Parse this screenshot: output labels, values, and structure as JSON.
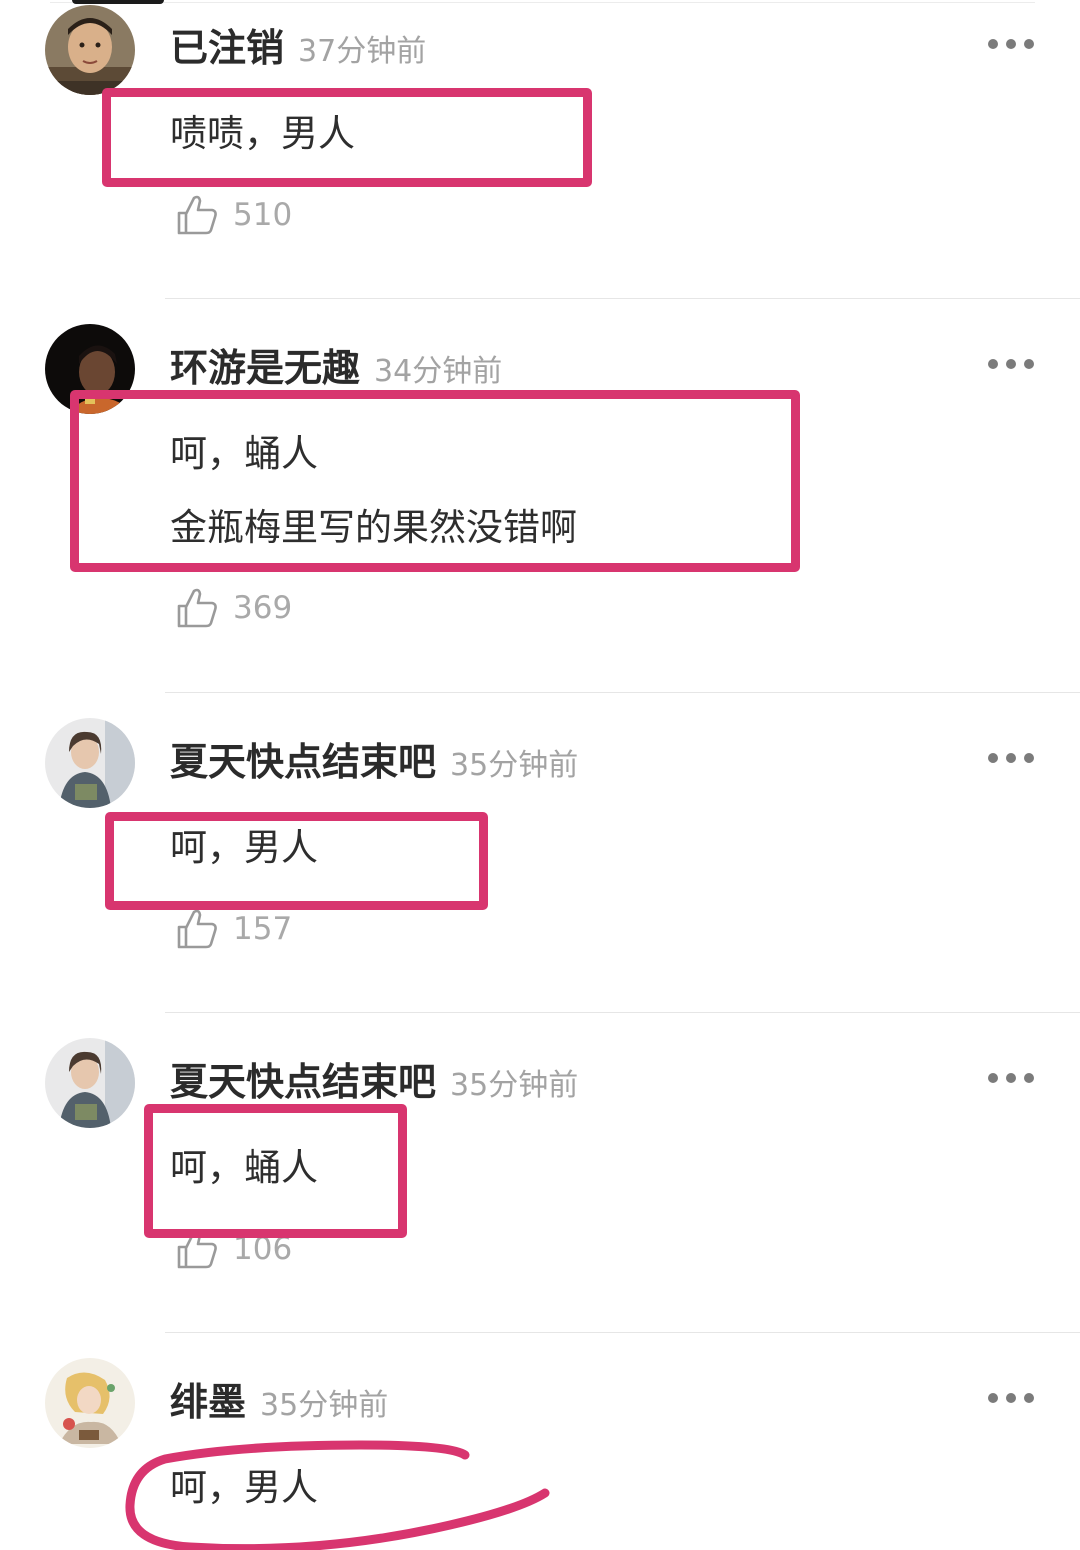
{
  "comments": [
    {
      "username": "已注销",
      "time": "37分钟前",
      "lines": [
        "啧啧，男人"
      ],
      "likes": "510",
      "avatar": "avatar-man-photo"
    },
    {
      "username": "环游是无趣",
      "time": "34分钟前",
      "lines": [
        "呵，蛹人",
        "金瓶梅里写的果然没错啊"
      ],
      "likes": "369",
      "avatar": "avatar-dark-portrait"
    },
    {
      "username": "夏天快点结束吧",
      "time": "35分钟前",
      "lines": [
        "呵，男人"
      ],
      "likes": "157",
      "avatar": "avatar-girl-photo"
    },
    {
      "username": "夏天快点结束吧",
      "time": "35分钟前",
      "lines": [
        "呵，蛹人"
      ],
      "likes": "106",
      "avatar": "avatar-girl-photo"
    },
    {
      "username": "绯墨",
      "time": "35分钟前",
      "lines": [
        "呵，男人"
      ],
      "likes": "",
      "avatar": "avatar-illustration"
    }
  ],
  "icons": {
    "like": "thumbs-up-icon",
    "more": "more-dots-icon"
  },
  "colors": {
    "highlight": "#d8356f",
    "username": "#2b2b2b",
    "timestamp": "#a3a3a3",
    "body": "#2e2e2e",
    "like_count": "#a9a9a9"
  }
}
